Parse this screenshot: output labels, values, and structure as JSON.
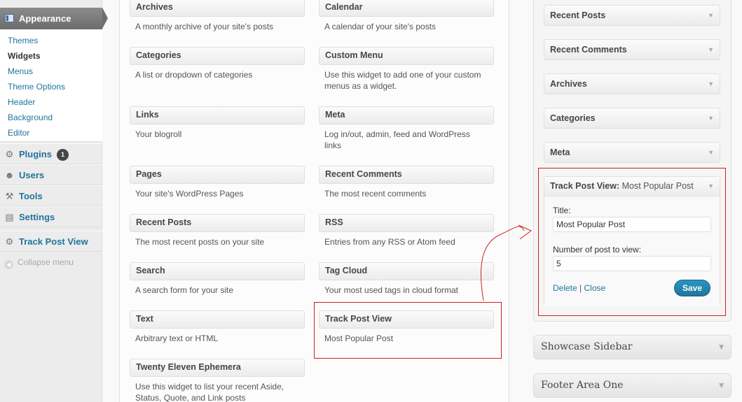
{
  "menu": {
    "appearance": "Appearance",
    "submenu": [
      "Themes",
      "Widgets",
      "Menus",
      "Theme Options",
      "Header",
      "Background",
      "Editor"
    ],
    "current": "Widgets",
    "plugins": "Plugins",
    "plugins_badge": "1",
    "users": "Users",
    "tools": "Tools",
    "settings": "Settings",
    "track_post_view": "Track Post View",
    "collapse": "Collapse menu"
  },
  "available_widgets": [
    {
      "title": "Archives",
      "desc": "A monthly archive of your site's posts"
    },
    {
      "title": "Calendar",
      "desc": "A calendar of your site's posts"
    },
    {
      "title": "Categories",
      "desc": "A list or dropdown of categories"
    },
    {
      "title": "Custom Menu",
      "desc": "Use this widget to add one of your custom menus as a widget."
    },
    {
      "title": "Links",
      "desc": "Your blogroll"
    },
    {
      "title": "Meta",
      "desc": "Log in/out, admin, feed and WordPress links"
    },
    {
      "title": "Pages",
      "desc": "Your site's WordPress Pages"
    },
    {
      "title": "Recent Comments",
      "desc": "The most recent comments"
    },
    {
      "title": "Recent Posts",
      "desc": "The most recent posts on your site"
    },
    {
      "title": "RSS",
      "desc": "Entries from any RSS or Atom feed"
    },
    {
      "title": "Search",
      "desc": "A search form for your site"
    },
    {
      "title": "Tag Cloud",
      "desc": "Your most used tags in cloud format"
    },
    {
      "title": "Text",
      "desc": "Arbitrary text or HTML"
    },
    {
      "title": "Track Post View",
      "desc": "Most Popular Post"
    },
    {
      "title": "Twenty Eleven Ephemera",
      "desc": "Use this widget to list your recent Aside, Status, Quote, and Link posts"
    }
  ],
  "sidebar_widgets": [
    "Recent Posts",
    "Recent Comments",
    "Archives",
    "Categories",
    "Meta"
  ],
  "open_widget": {
    "title": "Track Post View:",
    "instance_name": "Most Popular Post",
    "title_label": "Title:",
    "title_value": "Most Popular Post",
    "count_label": "Number of post to view:",
    "count_value": "5",
    "delete": "Delete",
    "separator": "|",
    "close": "Close",
    "save": "Save"
  },
  "sidebars": [
    "Showcase Sidebar",
    "Footer Area One"
  ],
  "colors": {
    "link": "#21759b",
    "highlight": "#cc2222"
  }
}
